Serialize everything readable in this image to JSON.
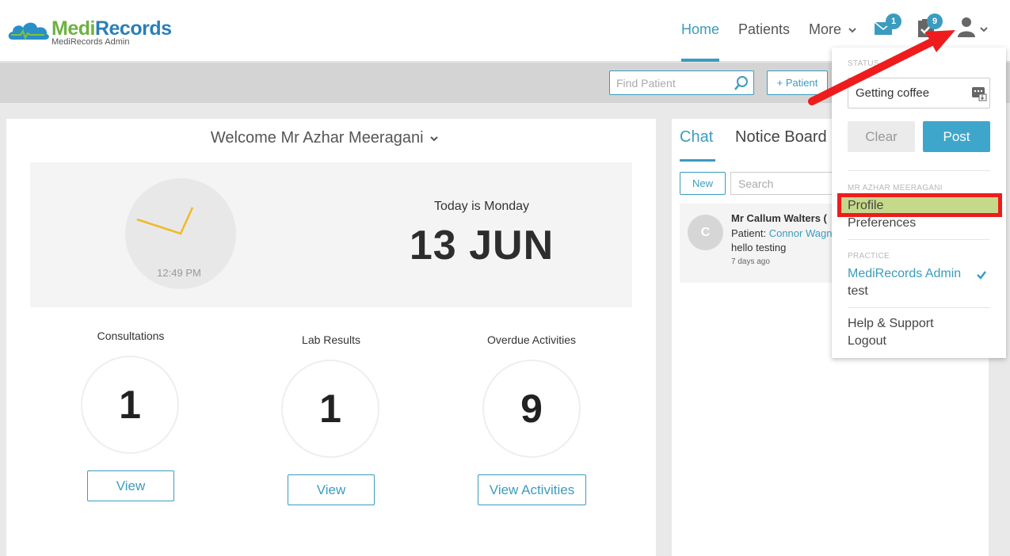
{
  "logo": {
    "medi": "Medi",
    "records": "Records",
    "subtitle": "MediRecords Admin"
  },
  "nav": {
    "home": "Home",
    "patients": "Patients",
    "more": "More",
    "messages_count": "1",
    "tasks_count": "9"
  },
  "toolbar": {
    "find_patient_placeholder": "Find Patient",
    "add_patient": "+ Patient"
  },
  "welcome": {
    "title": "Welcome Mr Azhar Meeragani",
    "clock_time": "12:49 PM",
    "today_label": "Today is Monday",
    "date": "13 JUN"
  },
  "stats": [
    {
      "label": "Consultations",
      "value": "1",
      "button": "View"
    },
    {
      "label": "Lab Results",
      "value": "1",
      "button": "View"
    },
    {
      "label": "Overdue Activities",
      "value": "9",
      "button": "View Activities"
    }
  ],
  "chat": {
    "tab_chat": "Chat",
    "tab_notice": "Notice Board",
    "new_button": "New",
    "search_placeholder": "Search",
    "message": {
      "avatar_initial": "C",
      "name": "Mr Callum Walters (",
      "patient_label": "Patient: ",
      "patient_name": "Connor Wagner",
      "text": "hello testing",
      "time": "7 days ago"
    }
  },
  "dropdown": {
    "status_label": "STATUS",
    "status_value": "Getting coffee",
    "clear": "Clear",
    "post": "Post",
    "user_label": "MR AZHAR MEERAGANI",
    "profile": "Profile",
    "preferences": "Preferences",
    "practice_label": "PRACTICE",
    "practice_name": "MediRecords Admin",
    "practice_test": "test",
    "help": "Help & Support",
    "logout": "Logout"
  },
  "colors": {
    "accent": "#3a9cbf",
    "logo_green": "#6cb33f",
    "logo_blue": "#2a7fb8",
    "annotation_red": "#ee1c1c",
    "highlight_green": "#c6d98b"
  },
  "icons": {
    "logo": "cloud-heartbeat-icon",
    "messages": "envelope-icon",
    "tasks": "clipboard-check-icon",
    "user": "user-icon",
    "search": "search-icon",
    "emoji": "emoji-picker-icon",
    "check": "checkmark-icon"
  }
}
